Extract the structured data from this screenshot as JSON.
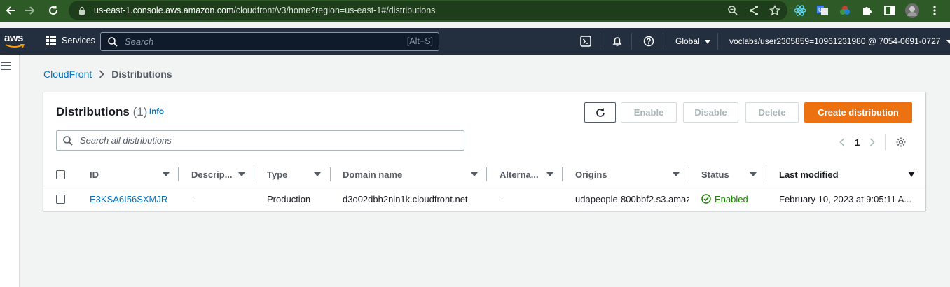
{
  "browser": {
    "url_host": "us-east-1.console.aws.amazon.com",
    "url_path": "/cloudfront/v3/home?region=us-east-1#/distributions"
  },
  "topnav": {
    "logo_text": "aws",
    "services_label": "Services",
    "search_placeholder": "Search",
    "search_shortcut": "[Alt+S]",
    "region_label": "Global",
    "account_label": "voclabs/user2305859=10961231980 @ 7054-0691-0727"
  },
  "breadcrumb": {
    "root": "CloudFront",
    "current": "Distributions"
  },
  "panel": {
    "title": "Distributions",
    "count": "(1)",
    "info_label": "Info",
    "buttons": {
      "enable": "Enable",
      "disable": "Disable",
      "delete": "Delete",
      "create": "Create distribution"
    },
    "search_placeholder": "Search all distributions",
    "page_number": "1"
  },
  "table": {
    "columns": [
      "ID",
      "Descrip...",
      "Type",
      "Domain name",
      "Alterna...",
      "Origins",
      "Status",
      "Last modified"
    ],
    "rows": [
      {
        "id": "E3KSA6I56SXMJR",
        "description": "-",
        "type": "Production",
        "domain": "d3o02dbh2nln1k.cloudfront.net",
        "alternate": "-",
        "origins": "udapeople-800bbf2.s3.amaz",
        "status": "Enabled",
        "last_modified": "February 10, 2023 at 9:05:11 A..."
      }
    ]
  },
  "colors": {
    "accent": "#ec7211",
    "link": "#0073bb",
    "success": "#1d8102",
    "nav_bg": "#232f3e",
    "browser_bg": "#2d5a27"
  }
}
